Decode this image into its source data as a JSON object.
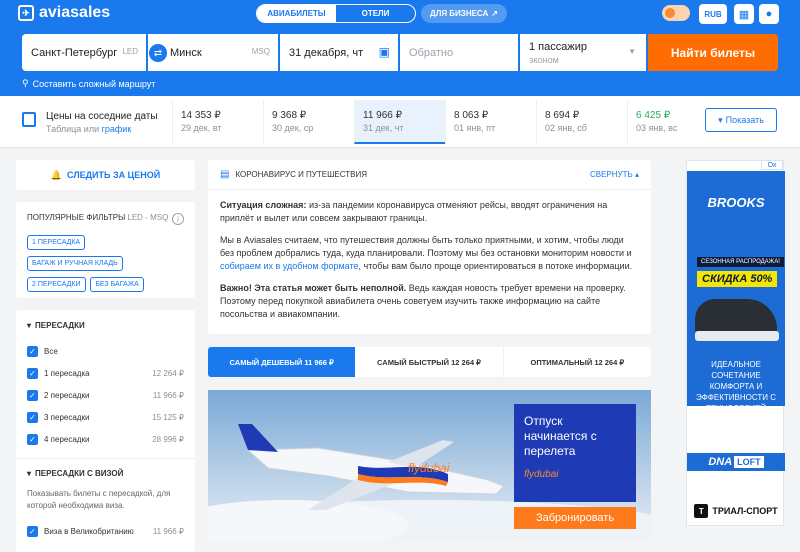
{
  "header": {
    "logo_text": "aviasales",
    "tabs": [
      "АВИАБИЛЕТЫ",
      "ОТЕЛИ"
    ],
    "business_label": "ДЛЯ БИЗНЕСА",
    "currency": "RUB",
    "accent": "#1a79ec"
  },
  "search": {
    "origin": "Санкт-Петербург",
    "origin_code": "LED",
    "destination": "Минск",
    "destination_code": "MSQ",
    "depart_date": "31 декабря, чт",
    "return_placeholder": "Обратно",
    "passengers": "1 пассажир",
    "cabin": "эконом",
    "find_button": "Найти билеты",
    "complex_route": "Составить сложный маршрут",
    "button_color": "#ff6d00"
  },
  "prices": {
    "title": "Цены на соседние даты",
    "sub_prefix": "Таблица или ",
    "sub_link": "график",
    "cells": [
      {
        "price": "14 353 ₽",
        "date": "29 дек, вт"
      },
      {
        "price": "9 368 ₽",
        "date": "30 дек, ср"
      },
      {
        "price": "11 966 ₽",
        "date": "31 дек, чт"
      },
      {
        "price": "8 063 ₽",
        "date": "01 янв, пт"
      },
      {
        "price": "8 694 ₽",
        "date": "02 янв, сб"
      },
      {
        "price": "6 425 ₽",
        "date": "03 янв, вс"
      }
    ],
    "show_button": "Показать"
  },
  "sidebar": {
    "follow_price": "СЛЕДИТЬ ЗА ЦЕНОЙ",
    "popular_title": "ПОПУЛЯРНЫЕ ФИЛЬТРЫ",
    "popular_route": "LED - MSQ",
    "chips": [
      "1 ПЕРЕСАДКА",
      "БАГАЖ И РУЧНАЯ КЛАДЬ",
      "2 ПЕРЕСАДКИ",
      "БЕЗ БАГАЖА"
    ],
    "transfers_title": "ПЕРЕСАДКИ",
    "transfers": [
      {
        "label": "Все",
        "price": ""
      },
      {
        "label": "1 пересадка",
        "price": "12 264 ₽"
      },
      {
        "label": "2 пересадки",
        "price": "11 966 ₽"
      },
      {
        "label": "3 пересадки",
        "price": "15 125 ₽"
      },
      {
        "label": "4 пересадки",
        "price": "28 996 ₽"
      }
    ],
    "visa_title": "ПЕРЕСАДКИ С ВИЗОЙ",
    "visa_hint": "Показывать билеты с пересадкой, для которой необходима виза.",
    "visa_item": {
      "label": "Виза в Великобританию",
      "price": "11 966 ₽"
    }
  },
  "covid": {
    "title": "КОРОНАВИРУС И ПУТЕШЕСТВИЯ",
    "collapse": "СВЕРНУТЬ",
    "p1_bold": "Ситуация сложная:",
    "p1": " из-за пандемии коронавируса отменяют рейсы, вводят ограничения на приплёт и вылет или совсем закрывают границы.",
    "p2a": "Мы в Aviasales считаем, что путешествия должны быть только приятными, и хотим, чтобы люди без проблем добрались туда, куда планировали. Поэтому мы без остановки мониторим новости и ",
    "p2_link": "собираем их в удобном формате",
    "p2b": ", чтобы вам было проще ориентироваться в потоке информации.",
    "p3_bold": "Важно! Эта статья может быть неполной.",
    "p3": " Ведь каждая новость требует времени на проверку. Поэтому перед покупкой авиабилета очень советуем изучить также информацию на сайте посольства и авиакомпании."
  },
  "sort_tabs": [
    "САМЫЙ ДЕШЕВЫЙ 11 966 ₽",
    "САМЫЙ БЫСТРЫЙ 12 264 ₽",
    "ОПТИМАЛЬНЫЙ 12 264 ₽"
  ],
  "banner": {
    "headline": "Отпуск начинается с перелета",
    "brand": "flydubai",
    "livery": "flydubai",
    "cta": "Забронировать"
  },
  "side_ad": {
    "badge": "Ох",
    "brand": "BROOKS",
    "sale_small": "СЕЗОННАЯ РАСПРОДАЖА!",
    "sale_big": "СКИДКА 50%",
    "tagline": "ИДЕАЛЬНОЕ СОЧЕТАНИЕ КОМФОРТА И ЭФФЕКТИВНОСТИ С ТЕХНОЛОГИЕЙ",
    "tech_a": "DNA",
    "tech_b": "LOFT",
    "store": "ТРИАЛ-СПОРТ"
  }
}
